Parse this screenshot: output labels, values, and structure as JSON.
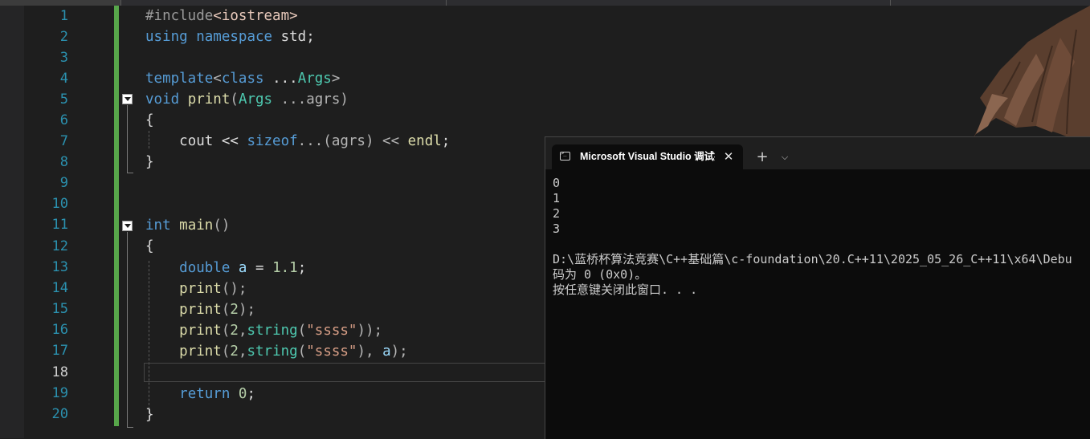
{
  "editor": {
    "line_numbers": [
      "1",
      "2",
      "3",
      "4",
      "5",
      "6",
      "7",
      "8",
      "9",
      "10",
      "11",
      "12",
      "13",
      "14",
      "15",
      "16",
      "17",
      "18",
      "19",
      "20"
    ],
    "current_line": "18",
    "code": {
      "l1_directive": "#include",
      "l1_header": "<iostream>",
      "l2_using": "using",
      "l2_namespace": "namespace",
      "l2_std": "std;",
      "l4_template": "template",
      "l4_lt": "<",
      "l4_class": "class",
      "l4_ellipsis": " ...",
      "l4_args": "Args",
      "l4_gt": ">",
      "l5_void": "void",
      "l5_print": "print",
      "l5_open": "(",
      "l5_args": "Args",
      "l5_param": " ...agrs)",
      "l6_brace": "{",
      "l7_cout": "cout << ",
      "l7_sizeof": "sizeof",
      "l7_rest": "...(agrs) << ",
      "l7_endl": "endl",
      "l7_semi": ";",
      "l8_brace": "}",
      "l11_int": "int",
      "l11_main": "main",
      "l11_parens": "()",
      "l12_brace": "{",
      "l13_double": "double",
      "l13_a": "a",
      "l13_eq": " = ",
      "l13_val": "1.1",
      "l13_semi": ";",
      "l14_print": "print",
      "l14_rest": "();",
      "l15_print": "print",
      "l15_open": "(",
      "l15_num": "2",
      "l15_close": ");",
      "l16_print": "print",
      "l16_open": "(",
      "l16_num": "2",
      "l16_comma": ",",
      "l16_string": "string",
      "l16_open2": "(",
      "l16_str": "\"ssss\"",
      "l16_close": "));",
      "l17_print": "print",
      "l17_open": "(",
      "l17_num": "2",
      "l17_comma": ",",
      "l17_string": "string",
      "l17_open2": "(",
      "l17_str": "\"ssss\"",
      "l17_mid": "), ",
      "l17_a": "a",
      "l17_close": ");",
      "l19_return": "return",
      "l19_val": "0",
      "l19_semi": ";",
      "l20_brace": "}"
    }
  },
  "console": {
    "tab_title": "Microsoft Visual Studio 调试控制台",
    "close_glyph": "✕",
    "new_tab_glyph": "+",
    "menu_glyph": "⌵",
    "output": [
      "0",
      "1",
      "2",
      "3",
      "",
      "D:\\蓝桥杯算法竞赛\\C++基础篇\\c-foundation\\20.C++11\\2025_05_26_C++11\\x64\\Debu",
      "码为 0 (0x0)。",
      "按任意键关闭此窗口. . ."
    ]
  },
  "colors": {
    "keyword": "#569cd6",
    "type": "#4ec9b0",
    "function": "#dcdcaa",
    "number": "#b5cea8",
    "string": "#d69d85",
    "line_number": "#2b91af",
    "change_bar": "#57a64a"
  }
}
